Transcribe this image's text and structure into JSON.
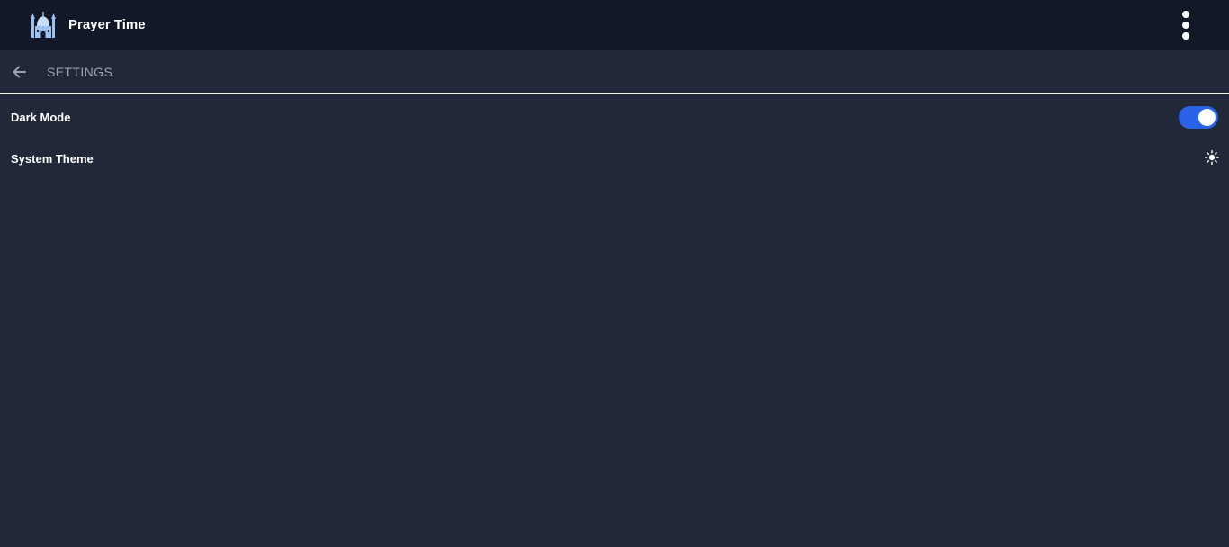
{
  "header": {
    "title": "Prayer Time",
    "logo_icon": "mosque-icon",
    "menu_icon": "more-vertical-icon"
  },
  "subheader": {
    "back_icon": "arrow-left-icon",
    "title": "SETTINGS"
  },
  "settings": {
    "dark_mode": {
      "label": "Dark Mode",
      "enabled": true
    },
    "system_theme": {
      "label": "System Theme",
      "icon": "sun-icon"
    }
  },
  "colors": {
    "topbar": "#121828",
    "background": "#212938",
    "accent": "#2a62e8",
    "divider": "#f2f2f2",
    "muted_text": "#9aa3b2"
  }
}
